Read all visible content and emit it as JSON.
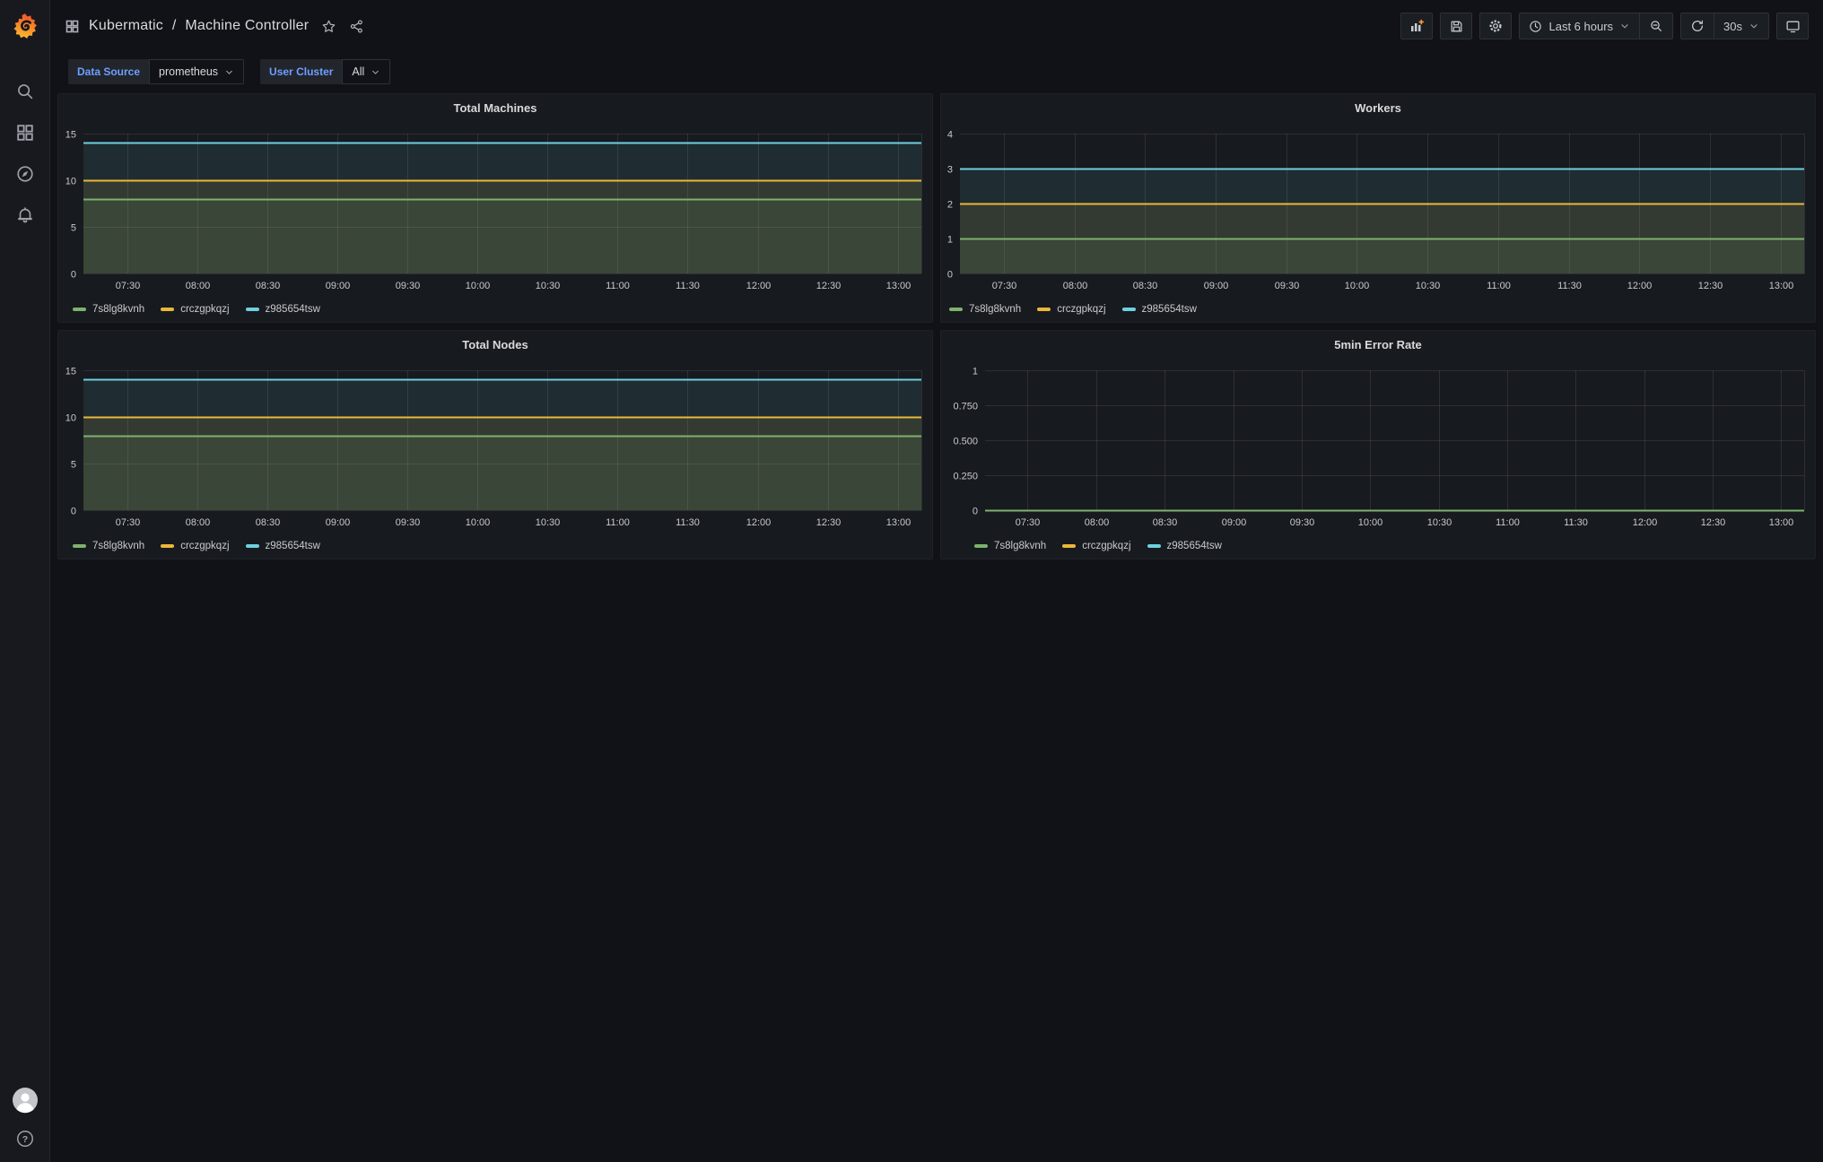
{
  "theme": {
    "accent_blue": "#6e9fff",
    "series_green": "#7EB26D",
    "series_yellow": "#EAB839",
    "series_cyan": "#6ED0E0",
    "grid_color": "rgba(204,204,220,0.12)"
  },
  "sidebar": {
    "icons": [
      "search-icon",
      "dashboards-icon",
      "explore-compass-icon",
      "alerting-bell-icon"
    ],
    "bottom_icons": [
      "user-avatar",
      "help-icon"
    ]
  },
  "topnav": {
    "breadcrumb": {
      "root": "Kubermatic",
      "separator": "/",
      "page": "Machine Controller"
    },
    "icons": [
      "apps-icon",
      "star-icon",
      "share-icon",
      "add-panel-icon",
      "save-icon",
      "settings-gear-icon",
      "clock-icon",
      "zoom-out-icon",
      "refresh-icon",
      "kiosk-monitor-icon"
    ],
    "time_range_label": "Last 6 hours",
    "refresh_interval": "30s"
  },
  "submenu": {
    "variables": [
      {
        "label": "Data Source",
        "value": "prometheus"
      },
      {
        "label": "User Cluster",
        "value": "All"
      }
    ]
  },
  "chart_data": [
    {
      "type": "line",
      "title": "Total Machines",
      "x": [
        "07:30",
        "08:00",
        "08:30",
        "09:00",
        "09:30",
        "10:00",
        "10:30",
        "11:00",
        "11:30",
        "12:00",
        "12:30",
        "13:00"
      ],
      "y_ticks": [
        {
          "value": 0,
          "label": "0"
        },
        {
          "value": 5,
          "label": "5"
        },
        {
          "value": 10,
          "label": "10"
        },
        {
          "value": 15,
          "label": "15"
        }
      ],
      "ylim": [
        0,
        15
      ],
      "grid": true,
      "legend_position": "bottom",
      "series": [
        {
          "name": "7s8lg8kvnh",
          "color": "#7EB26D",
          "values": [
            8,
            8,
            8,
            8,
            8,
            8,
            8,
            8,
            8,
            8,
            8,
            8
          ]
        },
        {
          "name": "crczgpkqzj",
          "color": "#EAB839",
          "values": [
            10,
            10,
            10,
            10,
            10,
            10,
            10,
            10,
            10,
            10,
            10,
            10
          ]
        },
        {
          "name": "z985654tsw",
          "color": "#6ED0E0",
          "values": [
            14,
            14,
            14,
            14,
            14,
            14,
            14,
            14,
            14,
            14,
            14,
            14
          ]
        }
      ]
    },
    {
      "type": "line",
      "title": "Workers",
      "x": [
        "07:30",
        "08:00",
        "08:30",
        "09:00",
        "09:30",
        "10:00",
        "10:30",
        "11:00",
        "11:30",
        "12:00",
        "12:30",
        "13:00"
      ],
      "y_ticks": [
        {
          "value": 0,
          "label": "0"
        },
        {
          "value": 1,
          "label": "1"
        },
        {
          "value": 2,
          "label": "2"
        },
        {
          "value": 3,
          "label": "3"
        },
        {
          "value": 4,
          "label": "4"
        }
      ],
      "ylim": [
        0,
        4
      ],
      "grid": true,
      "legend_position": "bottom",
      "series": [
        {
          "name": "7s8lg8kvnh",
          "color": "#7EB26D",
          "values": [
            1,
            1,
            1,
            1,
            1,
            1,
            1,
            1,
            1,
            1,
            1,
            1
          ]
        },
        {
          "name": "crczgpkqzj",
          "color": "#EAB839",
          "values": [
            2,
            2,
            2,
            2,
            2,
            2,
            2,
            2,
            2,
            2,
            2,
            2
          ]
        },
        {
          "name": "z985654tsw",
          "color": "#6ED0E0",
          "values": [
            3,
            3,
            3,
            3,
            3,
            3,
            3,
            3,
            3,
            3,
            3,
            3
          ]
        }
      ]
    },
    {
      "type": "line",
      "title": "Total Nodes",
      "x": [
        "07:30",
        "08:00",
        "08:30",
        "09:00",
        "09:30",
        "10:00",
        "10:30",
        "11:00",
        "11:30",
        "12:00",
        "12:30",
        "13:00"
      ],
      "y_ticks": [
        {
          "value": 0,
          "label": "0"
        },
        {
          "value": 5,
          "label": "5"
        },
        {
          "value": 10,
          "label": "10"
        },
        {
          "value": 15,
          "label": "15"
        }
      ],
      "ylim": [
        0,
        15
      ],
      "grid": true,
      "legend_position": "bottom",
      "series": [
        {
          "name": "7s8lg8kvnh",
          "color": "#7EB26D",
          "values": [
            8,
            8,
            8,
            8,
            8,
            8,
            8,
            8,
            8,
            8,
            8,
            8
          ]
        },
        {
          "name": "crczgpkqzj",
          "color": "#EAB839",
          "values": [
            10,
            10,
            10,
            10,
            10,
            10,
            10,
            10,
            10,
            10,
            10,
            10
          ]
        },
        {
          "name": "z985654tsw",
          "color": "#6ED0E0",
          "values": [
            14,
            14,
            14,
            14,
            14,
            14,
            14,
            14,
            14,
            14,
            14,
            14
          ]
        }
      ]
    },
    {
      "type": "line",
      "title": "5min Error Rate",
      "x": [
        "07:30",
        "08:00",
        "08:30",
        "09:00",
        "09:30",
        "10:00",
        "10:30",
        "11:00",
        "11:30",
        "12:00",
        "12:30",
        "13:00"
      ],
      "y_ticks": [
        {
          "value": 0,
          "label": "0"
        },
        {
          "value": 0.25,
          "label": "0.250"
        },
        {
          "value": 0.5,
          "label": "0.500"
        },
        {
          "value": 0.75,
          "label": "0.750"
        },
        {
          "value": 1,
          "label": "1"
        }
      ],
      "ylim": [
        0,
        1
      ],
      "grid": true,
      "legend_position": "bottom",
      "series": [
        {
          "name": "7s8lg8kvnh",
          "color": "#7EB26D",
          "values": [
            0,
            0,
            0,
            0,
            0,
            0,
            0,
            0,
            0,
            0,
            0,
            0
          ]
        },
        {
          "name": "crczgpkqzj",
          "color": "#EAB839",
          "values": [
            0,
            0,
            0,
            0,
            0,
            0,
            0,
            0,
            0,
            0,
            0,
            0
          ]
        },
        {
          "name": "z985654tsw",
          "color": "#6ED0E0",
          "values": [
            0,
            0,
            0,
            0,
            0,
            0,
            0,
            0,
            0,
            0,
            0,
            0
          ]
        }
      ]
    }
  ]
}
